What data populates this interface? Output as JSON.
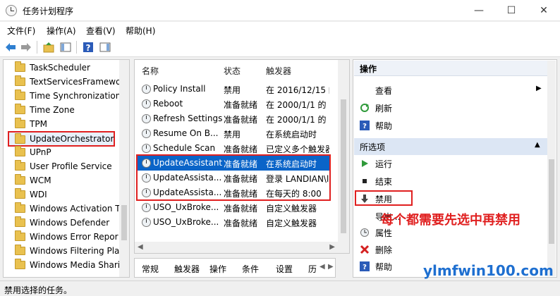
{
  "window": {
    "title": "任务计划程序",
    "min_glyph": "—",
    "max_glyph": "☐",
    "close_glyph": "✕"
  },
  "menu": [
    "文件(F)",
    "操作(A)",
    "查看(V)",
    "帮助(H)"
  ],
  "tree": {
    "items": [
      "TaskScheduler",
      "TextServicesFramewor",
      "Time Synchronization",
      "Time Zone",
      "TPM",
      "UpdateOrchestrator",
      "UPnP",
      "User Profile Service",
      "WCM",
      "WDI",
      "Windows Activation Te",
      "Windows Defender",
      "Windows Error Repor",
      "Windows Filtering Plat",
      "Windows Media Shari"
    ],
    "selected_index": 5
  },
  "tasks": {
    "columns": [
      "名称",
      "状态",
      "触发器"
    ],
    "rows": [
      {
        "name": "Policy Install",
        "status": "禁用",
        "trigger": "在 2016/12/15 的"
      },
      {
        "name": "Reboot",
        "status": "准备就绪",
        "trigger": "在 2000/1/1 的 3:"
      },
      {
        "name": "Refresh Settings",
        "status": "准备就绪",
        "trigger": "在 2000/1/1 的 3:"
      },
      {
        "name": "Resume On B...",
        "status": "禁用",
        "trigger": "在系统启动时"
      },
      {
        "name": "Schedule Scan",
        "status": "准备就绪",
        "trigger": "已定义多个触发器"
      },
      {
        "name": "UpdateAssistant",
        "status": "准备就绪",
        "trigger": "在系统启动时"
      },
      {
        "name": "UpdateAssista...",
        "status": "准备就绪",
        "trigger": "登录 LANDIAN\\lo"
      },
      {
        "name": "UpdateAssista...",
        "status": "准备就绪",
        "trigger": "在每天的 8:00"
      },
      {
        "name": "USO_UxBroke...",
        "status": "准备就绪",
        "trigger": "自定义触发器"
      },
      {
        "name": "USO_UxBroke...",
        "status": "准备就绪",
        "trigger": "自定义触发器"
      }
    ],
    "selected_index": 5
  },
  "tabs": [
    "常规",
    "触发器",
    "操作",
    "条件",
    "设置",
    "历"
  ],
  "actions": {
    "header": "操作",
    "top_items": [
      "查看",
      "刷新",
      "帮助"
    ],
    "section": "所选项",
    "items": [
      "运行",
      "结束",
      "禁用",
      "导出...",
      "属性",
      "删除",
      "帮助"
    ]
  },
  "annotation": "每个都需要先选中再禁用",
  "watermark": "ylmfwin100.com",
  "status": "禁用选择的任务。",
  "colors": {
    "selection": "#0a64c8",
    "highlight_box": "#e02020",
    "annotation_text": "#e02020",
    "actions_section": "#dce6f4"
  }
}
